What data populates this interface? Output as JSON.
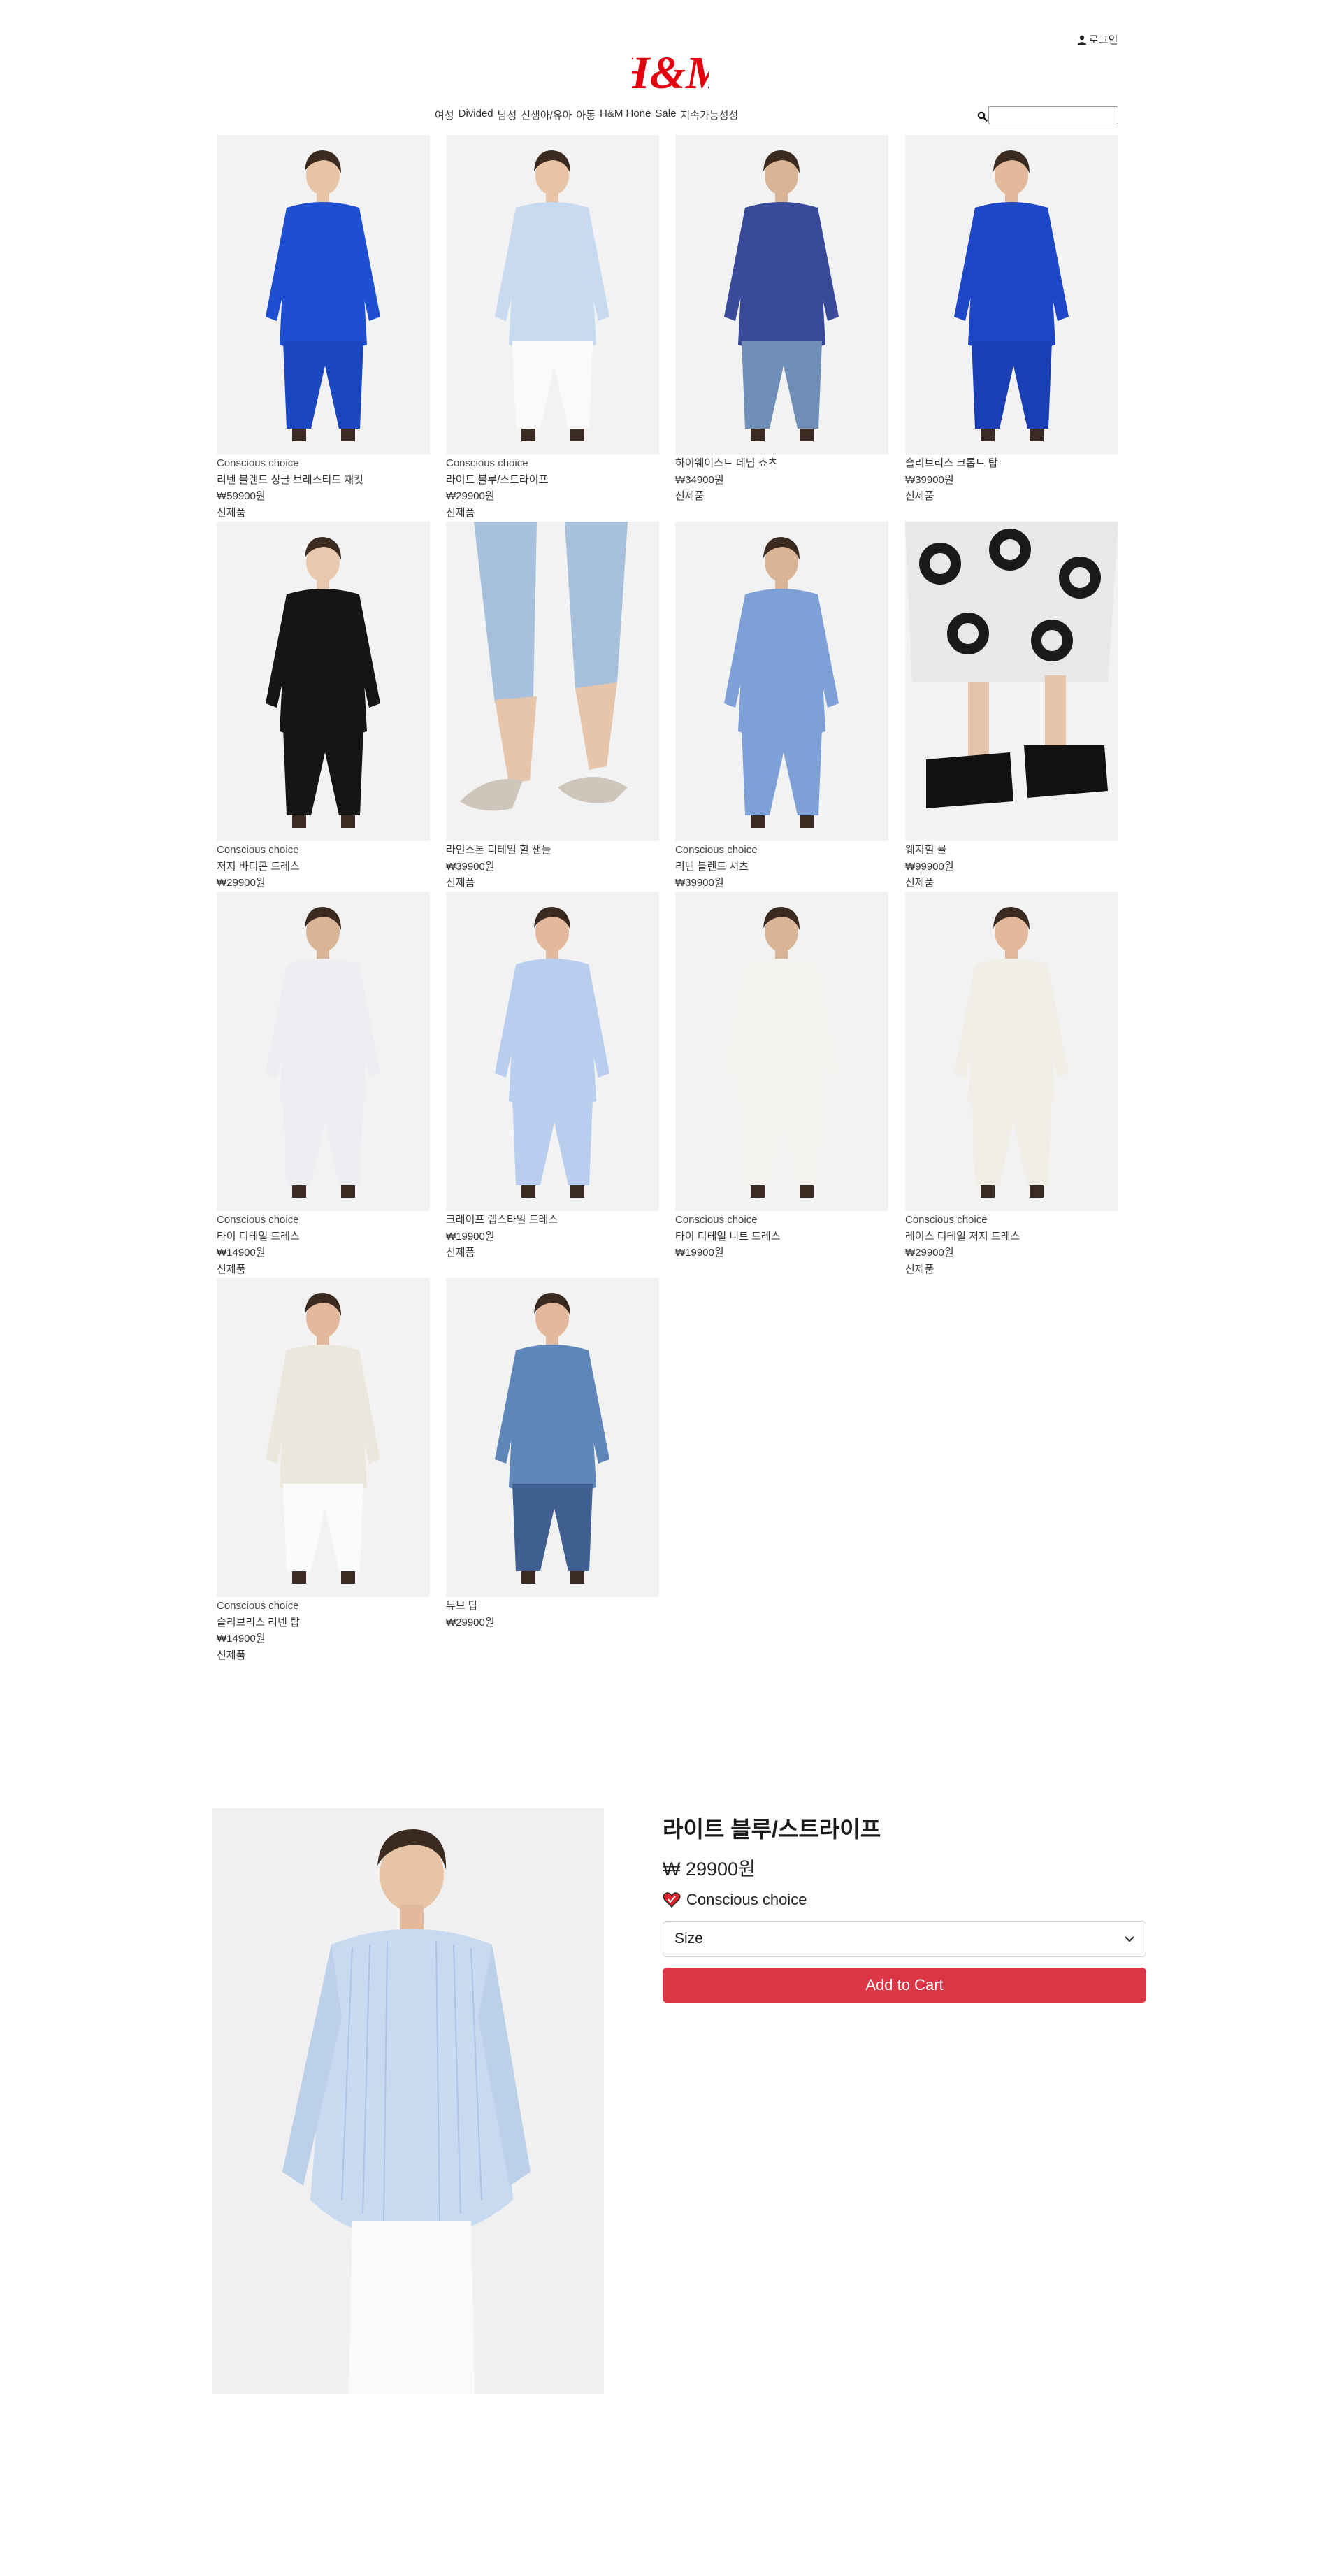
{
  "header": {
    "login_label": "로그인",
    "logo_text": "H&M",
    "nav": [
      "여성",
      "Divided",
      "남성",
      "신생아/유아",
      "아동",
      "H&M Hone",
      "Sale",
      "지속가능성성"
    ],
    "search": {
      "placeholder": "",
      "value": ""
    }
  },
  "products": [
    {
      "badge": "Conscious choice",
      "name": "리넨 블렌드 싱글 브레스티드 재킷",
      "price": "₩59900원",
      "tag": "신제품",
      "image": "blue-blazer-model"
    },
    {
      "badge": "Conscious choice",
      "name": "라이트 블루/스트라이프",
      "price": "₩29900원",
      "tag": "신제품",
      "image": "light-blue-striped-shirt-model"
    },
    {
      "badge": "",
      "name": "하이웨이스트 데님 쇼츠",
      "price": "₩34900원",
      "tag": "신제품",
      "image": "striped-shirt-denim-shorts-model"
    },
    {
      "badge": "",
      "name": "슬리브리스 크롭트 탑",
      "price": "₩39900원",
      "tag": "신제품",
      "image": "blue-crop-top-model"
    },
    {
      "badge": "Conscious choice",
      "name": "저지 바디콘 드레스",
      "price": "₩29900원",
      "tag": "",
      "image": "black-bodycon-dress-model"
    },
    {
      "badge": "",
      "name": "라인스톤 디테일 힐 샌들",
      "price": "₩39900원",
      "tag": "신제품",
      "image": "rhinestone-heel-sandals"
    },
    {
      "badge": "Conscious choice",
      "name": "리넨 블렌드 셔츠",
      "price": "₩39900원",
      "tag": "",
      "image": "striped-shirt-set-model"
    },
    {
      "badge": "",
      "name": "웨지힐 뮬",
      "price": "₩99900원",
      "tag": "신제품",
      "image": "wedge-mules-patterned-skirt"
    },
    {
      "badge": "Conscious choice",
      "name": "타이 디테일 드레스",
      "price": "₩14900원",
      "tag": "신제품",
      "image": "floral-slip-dress-model"
    },
    {
      "badge": "",
      "name": "크레이프 랩스타일 드레스",
      "price": "₩19900원",
      "tag": "신제품",
      "image": "blue-wrap-dress-model"
    },
    {
      "badge": "Conscious choice",
      "name": "타이 디테일 니트 드레스",
      "price": "₩19900원",
      "tag": "",
      "image": "white-knit-dress-model"
    },
    {
      "badge": "Conscious choice",
      "name": "레이스 디테일 저지 드레스",
      "price": "₩29900원",
      "tag": "신제품",
      "image": "white-lace-dress-model"
    },
    {
      "badge": "Conscious choice",
      "name": "슬리브리스 리넨 탑",
      "price": "₩14900원",
      "tag": "신제품",
      "image": "linen-tank-white-trousers-model"
    },
    {
      "badge": "",
      "name": "튜브 탑",
      "price": "₩29900원",
      "tag": "",
      "image": "tube-top-denim-jacket-model"
    }
  ],
  "detail": {
    "title": "라이트 블루/스트라이프",
    "price": "₩ 29900원",
    "badge": "Conscious choice",
    "size_label": "Size",
    "add_to_cart": "Add to Cart",
    "image": "light-blue-striped-shirt-model"
  },
  "colors": {
    "brand_red": "#e50010",
    "cart_button": "#dc3545",
    "image_bg": "#f2f2f2"
  }
}
